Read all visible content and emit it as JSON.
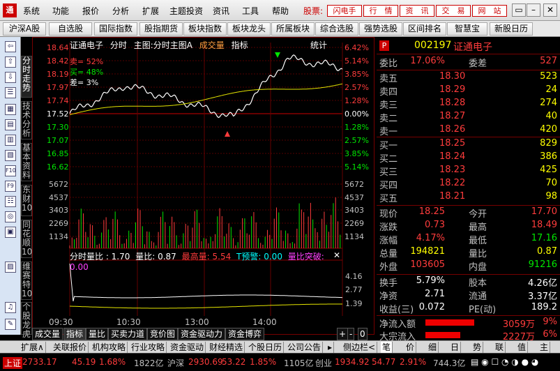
{
  "menu": {
    "logo": "通",
    "items": [
      "系统",
      "功能",
      "报价",
      "分析",
      "扩展",
      "主题投资",
      "资讯",
      "工具",
      "帮助"
    ],
    "stock_label": "股票:",
    "quick": [
      "闪电手",
      "行　情",
      "资　讯",
      "交　易",
      "网　站"
    ],
    "win": [
      "▭",
      "–",
      "▭",
      "✕"
    ]
  },
  "tabs": [
    "沪深A股",
    "自选股",
    "国际指数",
    "股指期货",
    "板块指数",
    "板块龙头",
    "所属板块",
    "综合选股",
    "强势选股",
    "区间排名",
    "智慧宝",
    "新股日历"
  ],
  "left_icons": [
    "⇦",
    "⇧",
    "⇩",
    "☰",
    "▦",
    "▤",
    "▥",
    "▧",
    "F10",
    "F9",
    "☷",
    "◎",
    "▣",
    "▨",
    "♫",
    "✎"
  ],
  "vtabs": [
    "分时走势",
    "技术分析",
    "基本资料",
    "东财10",
    "同花顺10",
    "维赛特10",
    "个股龙虎"
  ],
  "chart": {
    "title_items": [
      "证通电子",
      "分时",
      "主图:分时主图A",
      "成交量",
      "指标",
      "统计"
    ],
    "price_ticks_left": [
      "18.64",
      "18.42",
      "18.19",
      "17.97",
      "17.74",
      "17.52",
      "17.30",
      "17.07",
      "16.85",
      "16.62"
    ],
    "pct_ticks_right": [
      "6.42%",
      "5.14%",
      "3.85%",
      "2.57%",
      "1.28%",
      "0.00%",
      "1.28%",
      "2.57%",
      "3.85%",
      "5.14%"
    ],
    "vol_ticks": [
      "5672",
      "4537",
      "3403",
      "2269",
      "1134"
    ],
    "labels": {
      "sell": "卖= 52%",
      "buy": "买= 48%",
      "diff": "差= 3%"
    },
    "sub_title": [
      "分时量比 : 1.70",
      "量比: 0.87",
      "最高量: 5.54",
      "T预警: 0.00",
      "量比突破: 0.00"
    ],
    "sub_ticks": [
      "4.16",
      "2.77",
      "1.39"
    ],
    "times": [
      "09:30",
      "10:30",
      "13:00",
      "14:00"
    ]
  },
  "chart_data": {
    "type": "line",
    "x": [
      "09:30",
      "10:30",
      "13:00",
      "14:00",
      "15:00"
    ],
    "series": [
      {
        "values": [
          17.52,
          18.0,
          17.75,
          17.45,
          18.45,
          18.3
        ]
      }
    ],
    "ylim": [
      16.62,
      18.64
    ]
  },
  "panel": {
    "code": "002197",
    "name": "证通电子",
    "flag": "P",
    "weibi_l": "委比",
    "weibi_v": "17.06%",
    "weicha_l": "委差",
    "weicha_v": "527",
    "sells": [
      {
        "l": "卖五",
        "p": "18.30",
        "v": "523"
      },
      {
        "l": "卖四",
        "p": "18.29",
        "v": "24"
      },
      {
        "l": "卖三",
        "p": "18.28",
        "v": "274"
      },
      {
        "l": "卖二",
        "p": "18.27",
        "v": "40"
      },
      {
        "l": "卖一",
        "p": "18.26",
        "v": "420"
      }
    ],
    "buys": [
      {
        "l": "买一",
        "p": "18.25",
        "v": "829"
      },
      {
        "l": "买二",
        "p": "18.24",
        "v": "386"
      },
      {
        "l": "买三",
        "p": "18.23",
        "v": "425"
      },
      {
        "l": "买四",
        "p": "18.22",
        "v": "70"
      },
      {
        "l": "买五",
        "p": "18.21",
        "v": "98"
      }
    ],
    "stats": [
      {
        "l": "现价",
        "v": "18.25",
        "l2": "今开",
        "v2": "17.70"
      },
      {
        "l": "涨跌",
        "v": "0.73",
        "l2": "最高",
        "v2": "18.49"
      },
      {
        "l": "涨幅",
        "v": "4.17%",
        "l2": "最低",
        "v2": "17.16"
      },
      {
        "l": "总量",
        "v": "194821",
        "l2": "量比",
        "v2": "0.87"
      },
      {
        "l": "外盘",
        "v": "103605",
        "l2": "内盘",
        "v2": "91216"
      }
    ],
    "stats2": [
      {
        "l": "换手",
        "v": "5.79%",
        "l2": "股本",
        "v2": "4.26亿"
      },
      {
        "l": "净资",
        "v": "2.71",
        "l2": "流通",
        "v2": "3.37亿"
      },
      {
        "l": "收益(三)",
        "v": "0.072",
        "l2": "PE(动)",
        "v2": "189.2"
      }
    ],
    "flow1_l": "净流入额",
    "flow1_v": "3059万",
    "flow1_p": "9%",
    "flow2_l": "大宗流入",
    "flow2_v": "2227万",
    "flow2_p": "6%",
    "sidetabs": [
      "笔",
      "价",
      "细",
      "日",
      "势",
      "联",
      "值",
      "主"
    ]
  },
  "ftabs": [
    "成交量",
    "指标",
    "量比",
    "买卖力道",
    "竞价图",
    "资金驱动力",
    "资金博弈"
  ],
  "ftabs_right": [
    "+",
    "-",
    "0"
  ],
  "btabs": [
    "扩展∧",
    "关联报价",
    "机构攻略",
    "行业攻略",
    "资金驱动",
    "财经精选",
    "个股日历",
    "公司公告",
    "▸",
    "侧边栏<"
  ],
  "status": {
    "sh_l": "上证",
    "sh_v": "2733.17",
    "sh_c": "45.19",
    "sh_p": "1.68%",
    "sh_a": "1822亿",
    "sz_l": "沪深",
    "sz_v": "2930.69",
    "sz_c": "53.22",
    "sz_p": "1.85%",
    "sz_a": "1105亿",
    "cy_l": "创业",
    "cy_v": "1934.92",
    "cy_c": "54.77",
    "cy_p": "2.91%",
    "cy_a": "744.3亿"
  }
}
